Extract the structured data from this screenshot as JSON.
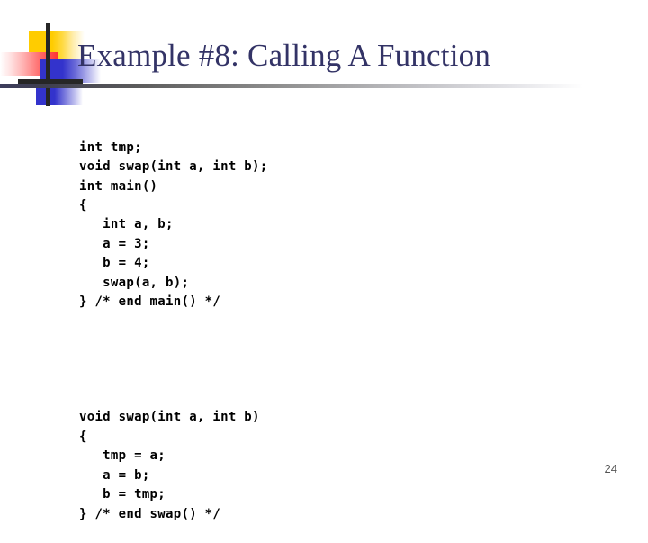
{
  "slide": {
    "title": "Example #8: Calling A Function",
    "page_number": "24",
    "colors": {
      "title_text": "#333366",
      "accent_yellow": "#ffcc00",
      "accent_red": "#ff3333",
      "accent_blue": "#3333cc",
      "bar_dark": "#262626",
      "code_text": "#000000"
    }
  },
  "code": {
    "block_main": "int tmp;\nvoid swap(int a, int b);\nint main()\n{\n   int a, b;\n   a = 3;\n   b = 4;\n   swap(a, b);\n} /* end main() */",
    "block_swap": "void swap(int a, int b)\n{\n   tmp = a;\n   a = b;\n   b = tmp;\n} /* end swap() */",
    "lines_main": [
      "int tmp;",
      "void swap(int a, int b);",
      "int main()",
      "{",
      "   int a, b;",
      "   a = 3;",
      "   b = 4;",
      "   swap(a, b);",
      "} /* end main() */"
    ],
    "lines_swap": [
      "void swap(int a, int b)",
      "{",
      "   tmp = a;",
      "   a = b;",
      "   b = tmp;",
      "} /* end swap() */"
    ]
  }
}
